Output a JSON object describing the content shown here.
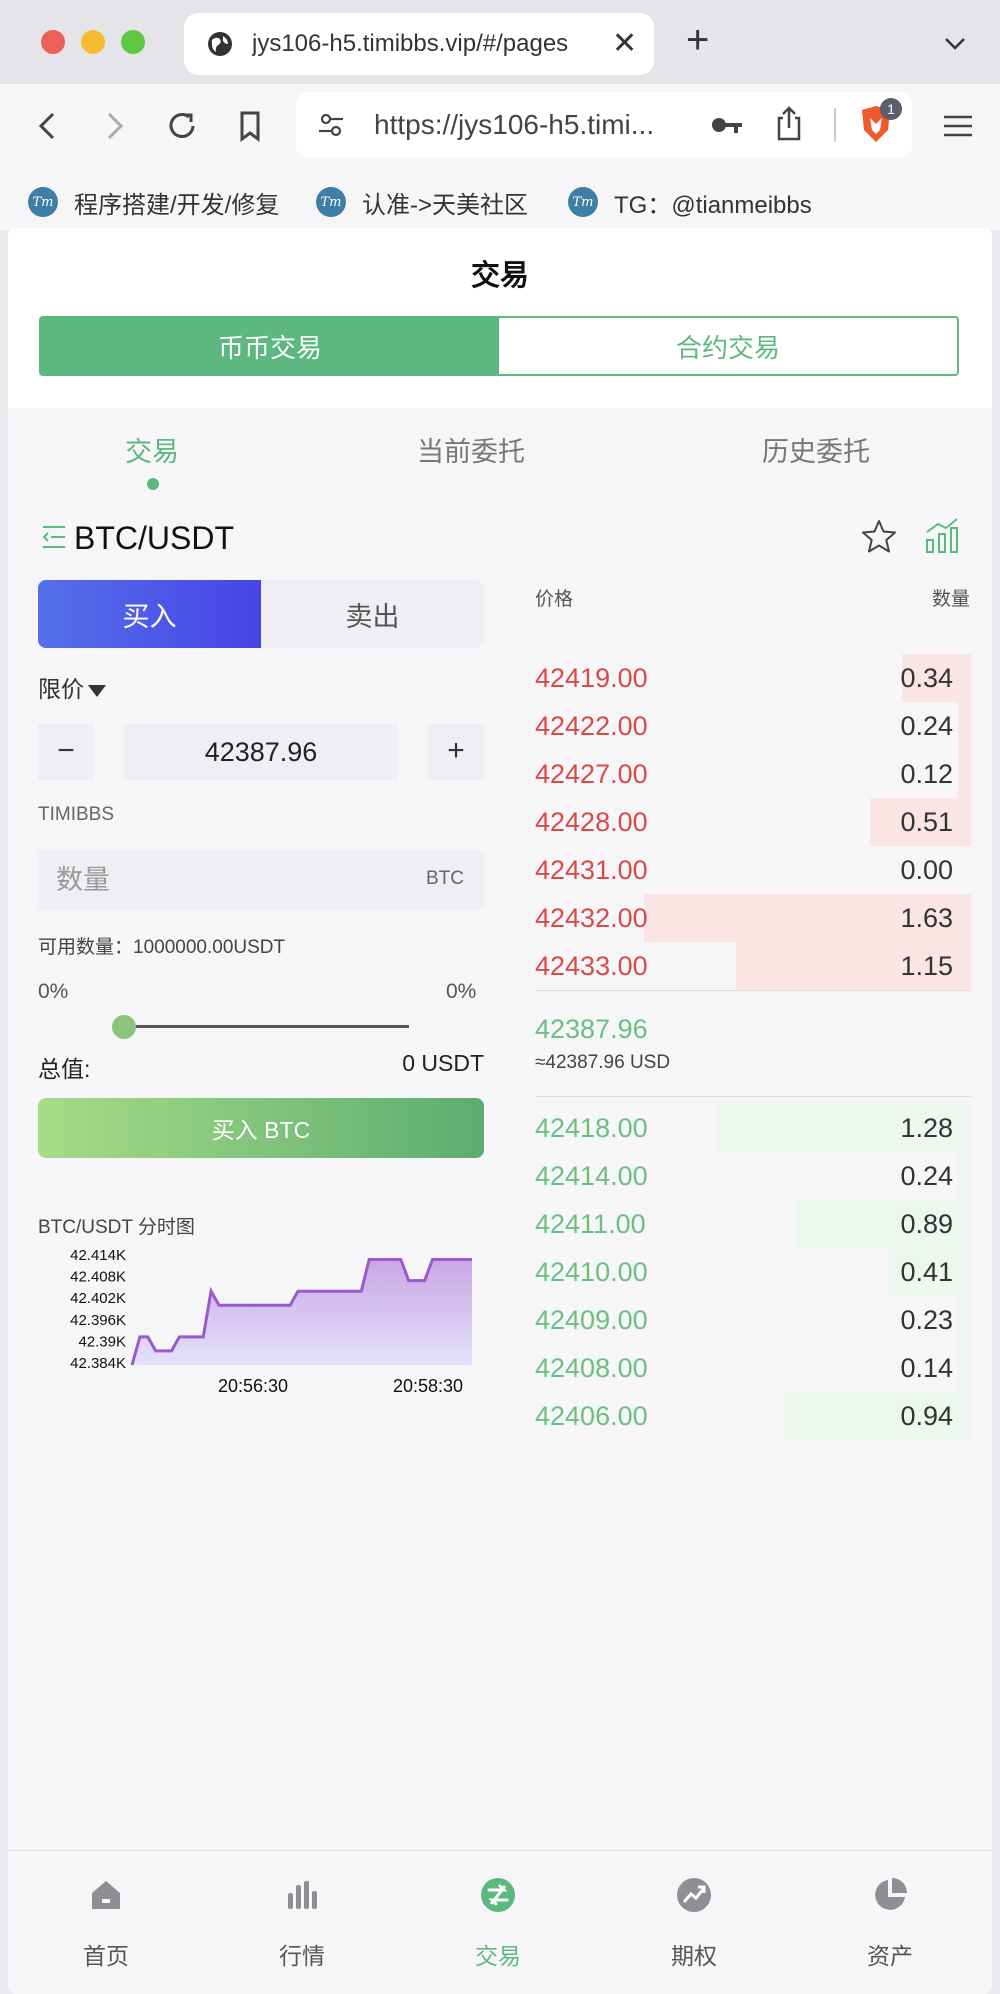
{
  "browser": {
    "tab_title": "jys106-h5.timibbs.vip/#/pages",
    "tab_close": "✕",
    "new_tab": "+",
    "url": "https://jys106-h5.timi...",
    "shield_badge": "1",
    "bookmarks": [
      {
        "icon_text": "Tm",
        "label": "程序搭建/开发/修复"
      },
      {
        "icon_text": "Tm",
        "label": "认准->天美社区"
      },
      {
        "icon_text": "Tm",
        "label": "TG：@tianmeibbs"
      }
    ]
  },
  "header": {
    "title": "交易",
    "segments": [
      "币币交易",
      "合约交易"
    ],
    "subtabs": [
      "交易",
      "当前委托",
      "历史委托"
    ]
  },
  "pair": {
    "name": "BTC/USDT"
  },
  "form": {
    "buy_label": "买入",
    "sell_label": "卖出",
    "order_type": "限价",
    "minus": "−",
    "plus": "+",
    "price": "42387.96",
    "brand": "TIMIBBS",
    "qty_placeholder": "数量",
    "qty_unit": "BTC",
    "available": "可用数量：1000000.00USDT",
    "pct_left": "0%",
    "pct_right": "0%",
    "slider_value": 0,
    "total_label": "总值:",
    "total_value": "0 USDT",
    "submit": "买入 BTC"
  },
  "mini_chart_title": "BTC/USDT 分时图",
  "chart_data": {
    "type": "area",
    "title": "",
    "ylabels": [
      "42.414K",
      "42.408K",
      "42.402K",
      "42.396K",
      "42.39K",
      "42.384K"
    ],
    "xlabels": [
      "20:56:30",
      "20:58:30"
    ],
    "ylim": [
      42384,
      42415
    ],
    "line_color": "#9b59d0",
    "values": [
      42384,
      42392,
      42392,
      42388,
      42388,
      42388,
      42392,
      42392,
      42392,
      42392,
      42405,
      42401,
      42401,
      42401,
      42401,
      42401,
      42401,
      42401,
      42401,
      42401,
      42401,
      42405,
      42405,
      42405,
      42405,
      42405,
      42405,
      42405,
      42405,
      42405,
      42414,
      42414,
      42414,
      42414,
      42414,
      42408,
      42408,
      42408,
      42414,
      42414,
      42414,
      42414,
      42414,
      42414
    ]
  },
  "orderbook": {
    "price_header": "价格",
    "qty_header": "数量",
    "asks": [
      {
        "price": "42419.00",
        "qty": "0.34",
        "depth": 0.21
      },
      {
        "price": "42422.00",
        "qty": "0.24",
        "depth": 0.04
      },
      {
        "price": "42427.00",
        "qty": "0.12",
        "depth": 0.04
      },
      {
        "price": "42428.00",
        "qty": "0.51",
        "depth": 0.31
      },
      {
        "price": "42431.00",
        "qty": "0.00",
        "depth": 0.0
      },
      {
        "price": "42432.00",
        "qty": "1.63",
        "depth": 1.0
      },
      {
        "price": "42433.00",
        "qty": "1.15",
        "depth": 0.72
      }
    ],
    "last_price": "42387.96",
    "last_usd": "≈42387.96 USD",
    "bids": [
      {
        "price": "42418.00",
        "qty": "1.28",
        "depth": 0.78
      },
      {
        "price": "42414.00",
        "qty": "0.24",
        "depth": 0.04
      },
      {
        "price": "42411.00",
        "qty": "0.89",
        "depth": 0.54
      },
      {
        "price": "42410.00",
        "qty": "0.41",
        "depth": 0.25
      },
      {
        "price": "42409.00",
        "qty": "0.23",
        "depth": 0.04
      },
      {
        "price": "42408.00",
        "qty": "0.14",
        "depth": 0.04
      },
      {
        "price": "42406.00",
        "qty": "0.94",
        "depth": 0.57
      }
    ]
  },
  "nav": {
    "items": [
      {
        "label": "首页",
        "icon": "home-icon"
      },
      {
        "label": "行情",
        "icon": "market-icon"
      },
      {
        "label": "交易",
        "icon": "trade-icon"
      },
      {
        "label": "期权",
        "icon": "options-icon"
      },
      {
        "label": "资产",
        "icon": "assets-icon"
      }
    ],
    "active_color": "#5cb87e",
    "inactive_color": "#555555"
  },
  "colors": {
    "accent": "#5cb87e",
    "ask": "#d94a4a",
    "bid": "#6cbf7f",
    "buy_tab": "#4f5ee8"
  }
}
